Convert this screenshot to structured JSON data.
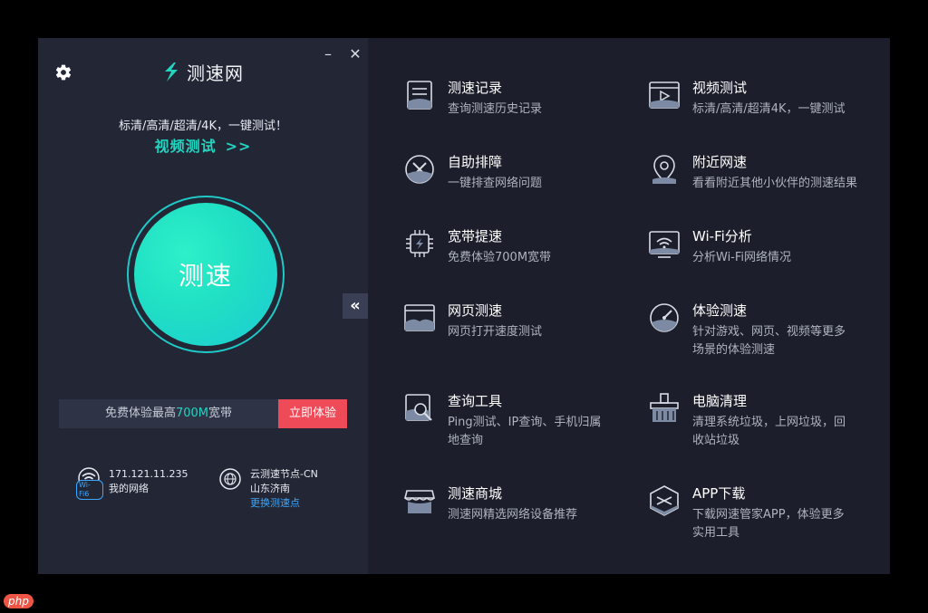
{
  "app": {
    "name": "测速网"
  },
  "window_controls": {
    "minimize": "–",
    "close": "✕"
  },
  "left": {
    "tagline": "标清/高清/超清/4K，一键测试！",
    "video_link": "视频测试",
    "video_arrows": ">>",
    "speed_button": "测速",
    "promo": {
      "text_pre": "免费体验最高",
      "text_highlight": "700M",
      "text_post": "宽带",
      "cta": "立即体验"
    },
    "collapse": "«",
    "network": {
      "ip": "171.121.11.235",
      "label": "我的网络",
      "badge": "Wi-Fi6"
    },
    "node": {
      "name": "云测速节点-CN",
      "city": "山东济南",
      "change": "更换测速点"
    }
  },
  "features": [
    {
      "title": "测速记录",
      "desc": "查询测速历史记录",
      "icon": "record-icon"
    },
    {
      "title": "视频测试",
      "desc": "标清/高清/超清4K，一键测试",
      "icon": "video-icon"
    },
    {
      "title": "自助排障",
      "desc": "一键排查网络问题",
      "icon": "repair-icon"
    },
    {
      "title": "附近网速",
      "desc": "看看附近其他小伙伴的测速结果",
      "icon": "location-icon"
    },
    {
      "title": "宽带提速",
      "desc": "免费体验700M宽带",
      "icon": "chip-icon"
    },
    {
      "title": "Wi-Fi分析",
      "desc": "分析Wi-Fi网络情况",
      "icon": "wifi-icon"
    },
    {
      "title": "网页测速",
      "desc": "网页打开速度测试",
      "icon": "webpage-icon"
    },
    {
      "title": "体验测速",
      "desc": "针对游戏、网页、视频等更多场景的体验测速",
      "icon": "gauge-icon"
    },
    {
      "title": "查询工具",
      "desc": "Ping测试、IP查询、手机归属地查询",
      "icon": "search-tool-icon"
    },
    {
      "title": "电脑清理",
      "desc": "清理系统垃圾，上网垃圾，回收站垃圾",
      "icon": "broom-icon"
    },
    {
      "title": "测速商城",
      "desc": "测速网精选网络设备推荐",
      "icon": "shop-icon"
    },
    {
      "title": "APP下载",
      "desc": "下载网速管家APP，体验更多实用工具",
      "icon": "app-icon"
    }
  ],
  "watermark": "php",
  "colors": {
    "accent": "#23d4c0",
    "cta": "#ef4a58",
    "link": "#3aa8ff"
  }
}
